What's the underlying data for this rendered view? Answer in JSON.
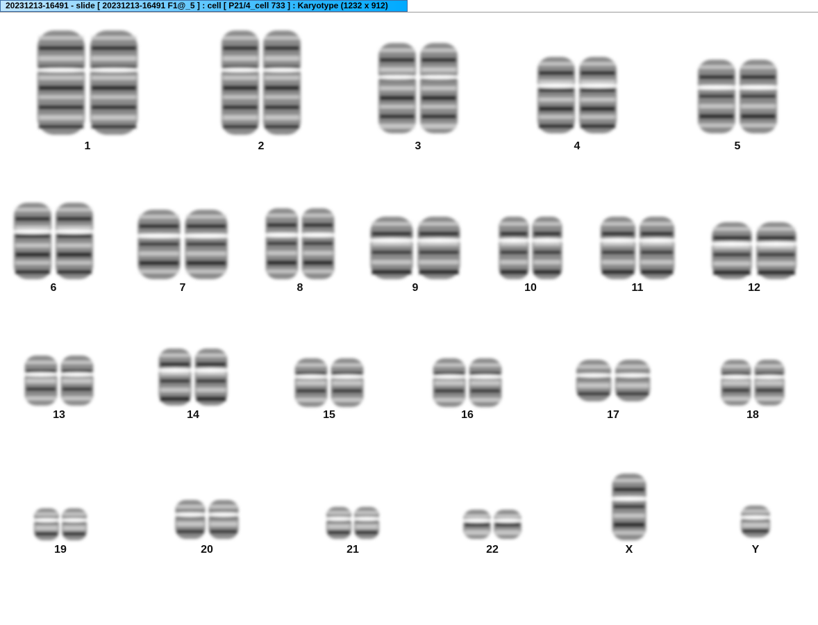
{
  "window": {
    "title": "20231213-16491 - slide [ 20231213-16491 F1@_5 ] : cell [ P21/4_cell 733 ] : Karyotype  (1232 x 912)"
  },
  "karyotype": {
    "rows": [
      [
        {
          "id": "1",
          "label": "1"
        },
        {
          "id": "2",
          "label": "2"
        },
        {
          "id": "3",
          "label": "3"
        },
        {
          "id": "4",
          "label": "4"
        },
        {
          "id": "5",
          "label": "5"
        }
      ],
      [
        {
          "id": "6",
          "label": "6"
        },
        {
          "id": "7",
          "label": "7"
        },
        {
          "id": "8",
          "label": "8"
        },
        {
          "id": "9",
          "label": "9"
        },
        {
          "id": "10",
          "label": "10"
        },
        {
          "id": "11",
          "label": "11"
        },
        {
          "id": "12",
          "label": "12"
        }
      ],
      [
        {
          "id": "13",
          "label": "13"
        },
        {
          "id": "14",
          "label": "14"
        },
        {
          "id": "15",
          "label": "15"
        },
        {
          "id": "16",
          "label": "16"
        },
        {
          "id": "17",
          "label": "17"
        },
        {
          "id": "18",
          "label": "18"
        }
      ],
      [
        {
          "id": "19",
          "label": "19"
        },
        {
          "id": "20",
          "label": "20"
        },
        {
          "id": "21",
          "label": "21"
        },
        {
          "id": "22",
          "label": "22"
        },
        {
          "id": "X",
          "label": "X"
        },
        {
          "id": "Y",
          "label": "Y"
        }
      ]
    ]
  }
}
